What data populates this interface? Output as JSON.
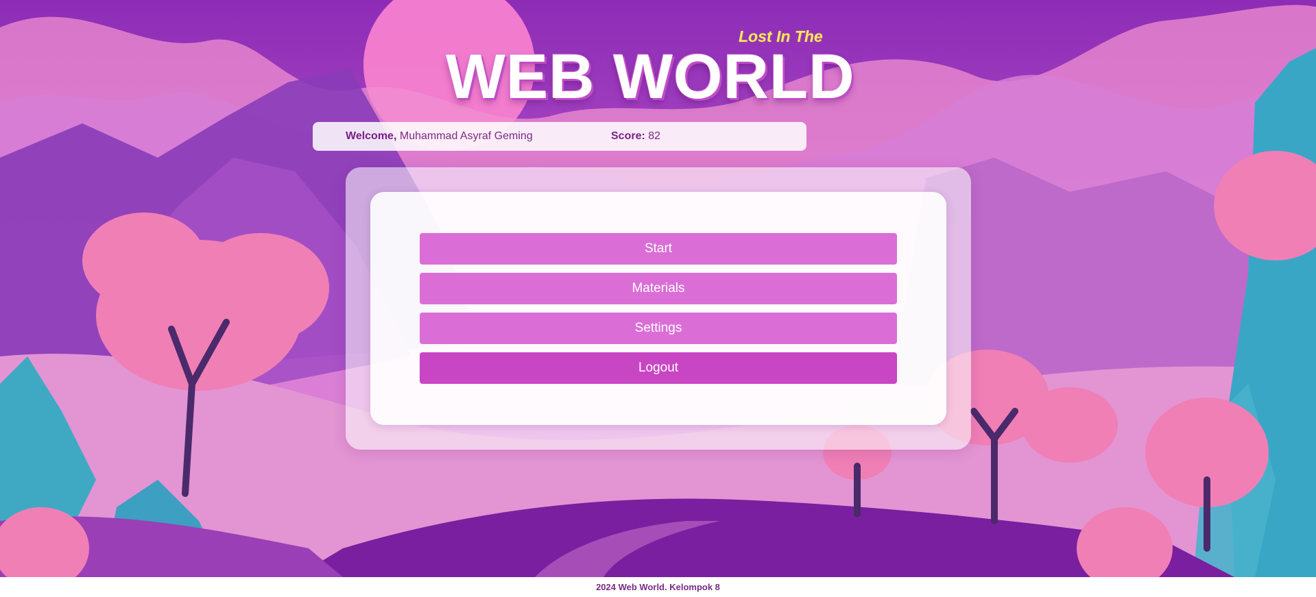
{
  "header": {
    "subtitle": "Lost In The",
    "title": "WEB WORLD"
  },
  "status": {
    "welcome_label": "Welcome,",
    "user_name": "Muhammad Asyraf Geming",
    "score_label": "Score:",
    "score_value": "82"
  },
  "menu": {
    "start": "Start",
    "materials": "Materials",
    "settings": "Settings",
    "logout": "Logout"
  },
  "footer": {
    "text": "2024 Web World. Kelompok 8"
  },
  "colors": {
    "accent": "#da6ed6",
    "logout": "#c845c3",
    "text_purple": "#7a2b86",
    "subtitle_yellow": "#f5ea5a"
  }
}
